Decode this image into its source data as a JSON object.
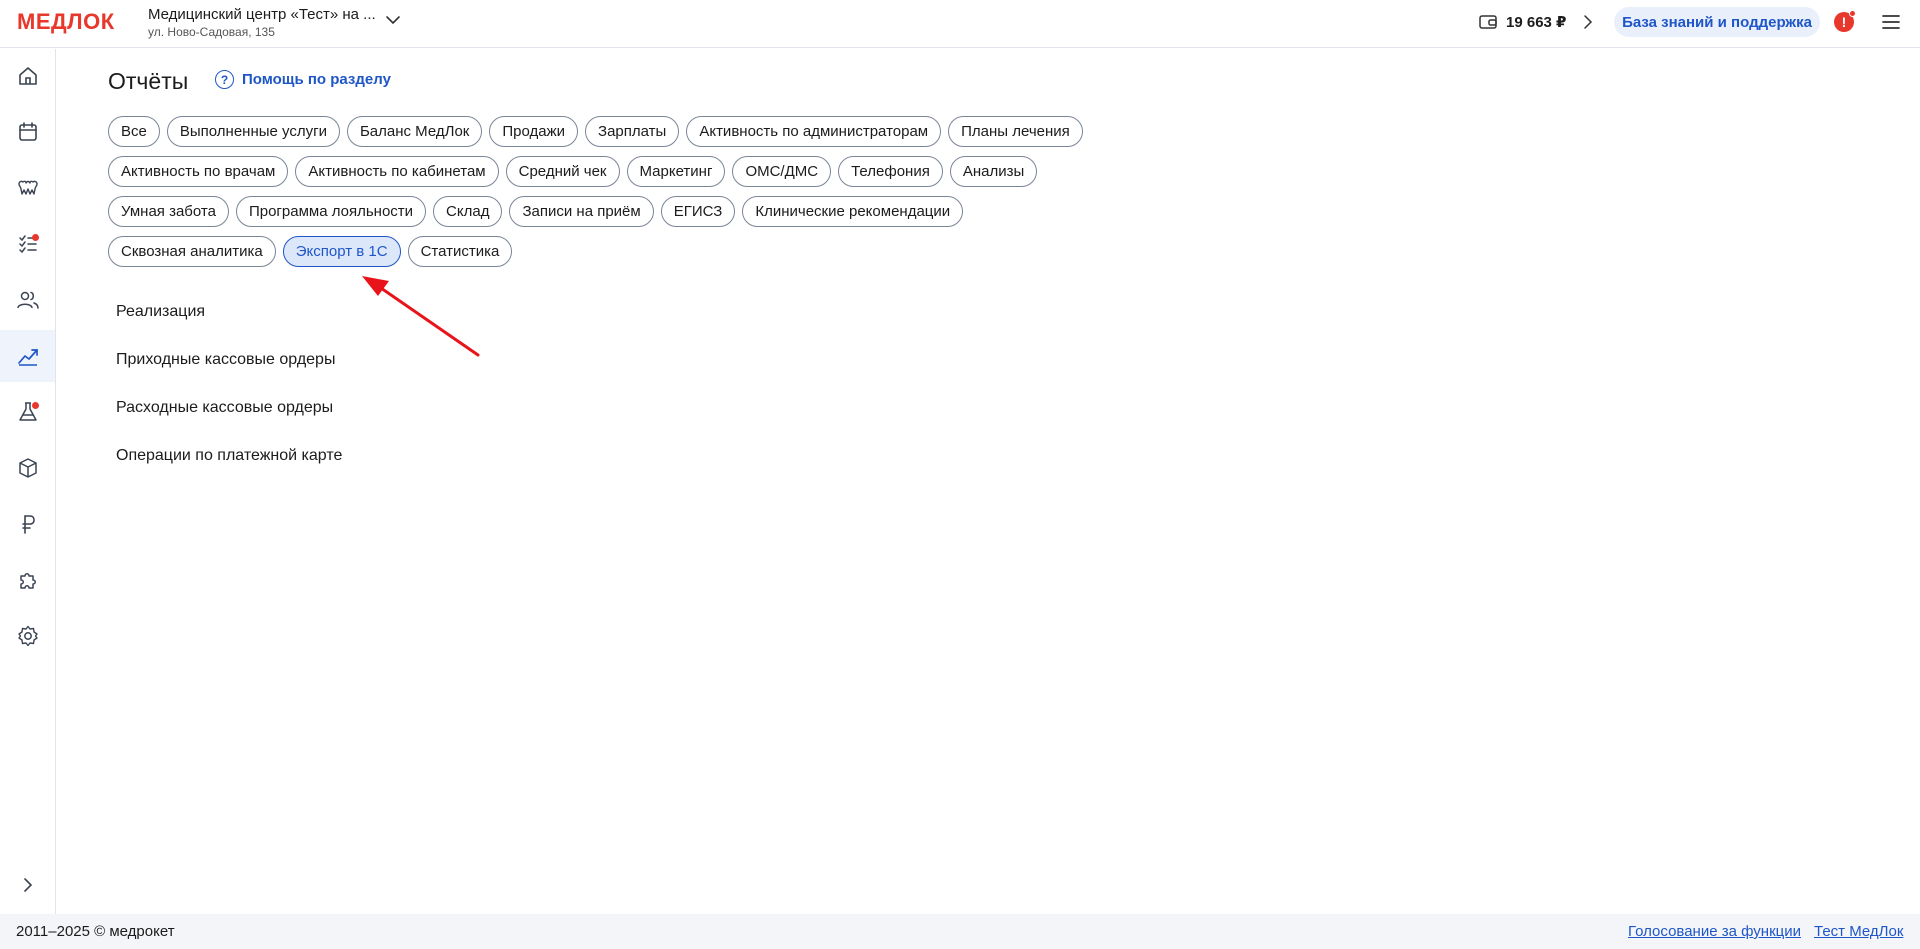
{
  "header": {
    "logo": "МЕДЛОК",
    "clinic_name": "Медицинский центр «Тест» на ...",
    "clinic_address": "ул. Ново-Садовая, 135",
    "balance": "19 663 ₽",
    "kb_button": "База знаний и поддержка",
    "alert_glyph": "!"
  },
  "sidebar": {
    "items": [
      {
        "icon": "home-icon"
      },
      {
        "icon": "calendar-icon"
      },
      {
        "icon": "teeth-icon"
      },
      {
        "icon": "tasks-icon",
        "badge": true
      },
      {
        "icon": "patients-icon"
      },
      {
        "icon": "reports-chart-icon",
        "active": true
      },
      {
        "icon": "lab-flask-icon",
        "badge": true
      },
      {
        "icon": "warehouse-box-icon"
      },
      {
        "icon": "finance-ruble-icon"
      },
      {
        "icon": "integrations-puzzle-icon"
      },
      {
        "icon": "settings-gear-icon"
      }
    ],
    "expand_icon": "chevron-right-icon"
  },
  "main": {
    "title": "Отчёты",
    "help": "Помощь по разделу",
    "help_glyph": "?",
    "chips": [
      [
        "Все",
        "Выполненные услуги",
        "Баланс МедЛок",
        "Продажи",
        "Зарплаты",
        "Активность по администраторам",
        "Планы лечения"
      ],
      [
        "Активность по врачам",
        "Активность по кабинетам",
        "Средний чек",
        "Маркетинг",
        "ОМС/ДМС",
        "Телефония",
        "Анализы"
      ],
      [
        "Умная забота",
        "Программа лояльности",
        "Склад",
        "Записи на приём",
        "ЕГИСЗ",
        "Клинические рекомендации"
      ],
      [
        "Сквозная аналитика",
        "Экспорт в 1С",
        "Статистика"
      ]
    ],
    "selected_chip": "Экспорт в 1С",
    "reports": [
      "Реализация",
      "Приходные кассовые ордеры",
      "Расходные кассовые ордеры",
      "Операции по платежной карте"
    ]
  },
  "footer": {
    "copyright": "2011–2025 © медрокет",
    "links": [
      "Голосование за функции",
      "Тест МедЛок"
    ]
  },
  "colors": {
    "brand": "#e8372b",
    "accent": "#1f56c7",
    "selected_chip_bg": "#dce7fa",
    "annotation_arrow": "#e8141a"
  }
}
